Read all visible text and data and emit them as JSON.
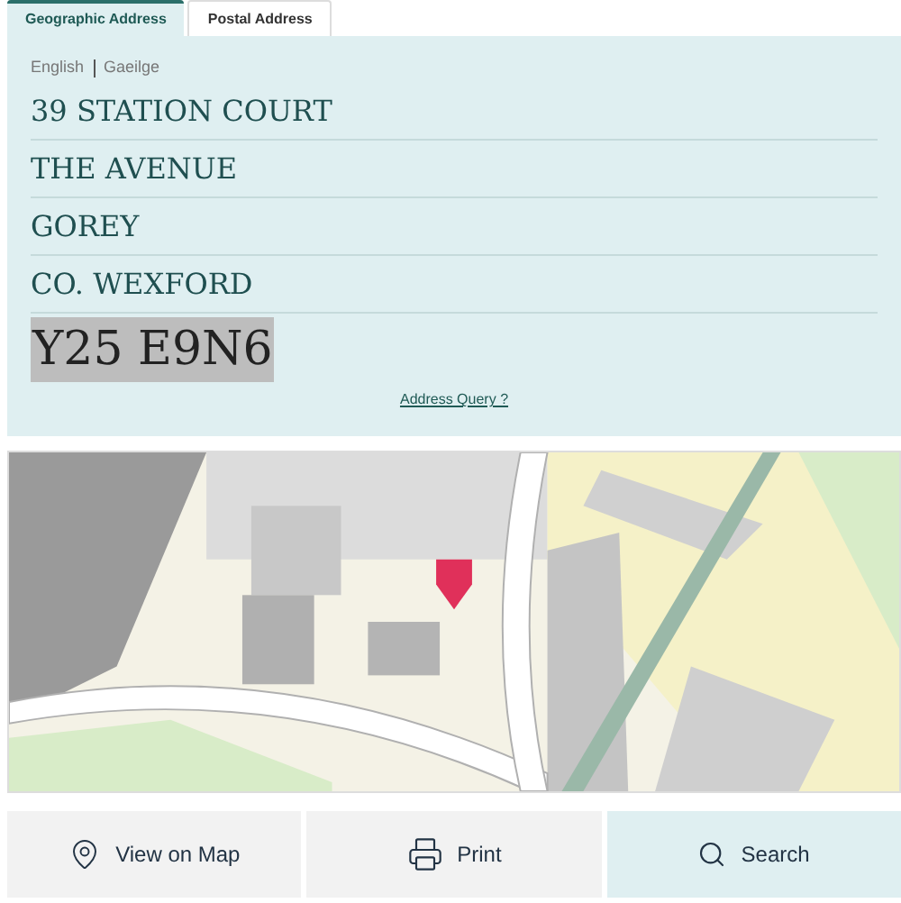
{
  "tabs": [
    {
      "label": "Geographic Address",
      "selected": true
    },
    {
      "label": "Postal Address",
      "selected": false
    }
  ],
  "languages": [
    "English",
    "Gaeilge"
  ],
  "address_lines": [
    "39 STATION COURT",
    "THE AVENUE",
    "GOREY",
    "CO. WEXFORD"
  ],
  "eircode": {
    "text": "Y25 E9N6",
    "highlighted": true
  },
  "query_link": "Address Query ?",
  "map": {
    "kind": "picture"
  },
  "buttons": [
    {
      "kind": "map",
      "label": "View on Map",
      "selected": false
    },
    {
      "kind": "print",
      "label": "Print",
      "selected": false
    },
    {
      "kind": "search",
      "label": "Search",
      "selected": true
    }
  ]
}
